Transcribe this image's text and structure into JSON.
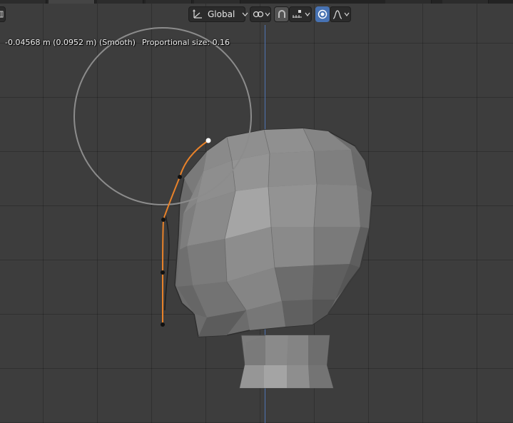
{
  "header": {
    "transform_orientation": "Global",
    "icons": {
      "toggle_left": "toolbar-toggle-icon",
      "orientation": "transform-axes-icon",
      "orientation_dropdown": "chevron-down-icon",
      "pivot": "link-icon",
      "snap": "magnet-icon",
      "snap_target": "increment-snap-icon",
      "proportional": "proportional-edit-icon",
      "falloff": "smooth-falloff-icon"
    }
  },
  "status": {
    "offset": "-0.04568 m (0.0952 m) (Smooth)",
    "proportional": "Proportional size: 0.16"
  },
  "colors": {
    "viewport_bg": "#3d3d3d",
    "grid": "#333333",
    "z_axis": "#4f74b3",
    "curve": "#e8822a",
    "proportional_circle": "#8c8c8c",
    "mesh": "#8a8a8a"
  }
}
